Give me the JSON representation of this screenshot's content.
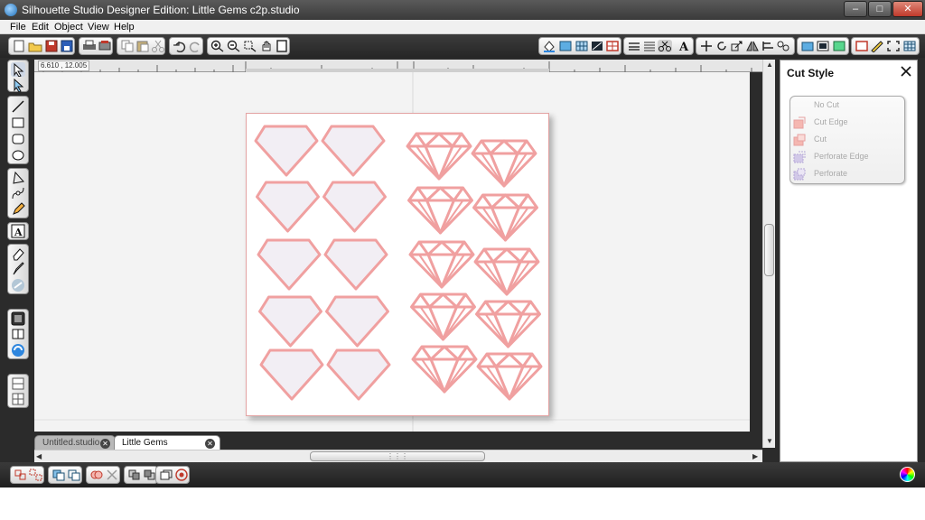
{
  "window": {
    "title": "Silhouette Studio Designer Edition: Little Gems c2p.studio",
    "controls": {
      "minimize": "–",
      "maximize": "□",
      "close": "✕"
    }
  },
  "menu": {
    "items": [
      "File",
      "Edit",
      "Object",
      "View",
      "Help"
    ]
  },
  "ruler": {
    "readout": "6.610 , 12.005"
  },
  "tabs": [
    {
      "label": "Untitled.studio",
      "active": false
    },
    {
      "label": "Little Gems c2p.studio",
      "active": true
    }
  ],
  "panel": {
    "title": "Cut Style",
    "options": [
      {
        "label": "No Cut",
        "icon": "no-cut-icon"
      },
      {
        "label": "Cut Edge",
        "icon": "cut-edge-icon"
      },
      {
        "label": "Cut",
        "icon": "cut-icon"
      },
      {
        "label": "Perforate Edge",
        "icon": "perforate-edge-icon"
      },
      {
        "label": "Perforate",
        "icon": "perforate-icon"
      }
    ]
  },
  "design": {
    "shape_stroke": "#f0a0a0",
    "shape_fill": "#f2eef4",
    "left_column": "outlined-gem shapes",
    "right_column": "faceted diamond shapes"
  },
  "colors": {
    "chrome_dark": "#2b2b2b",
    "menu_bg": "#f0f0f0",
    "workspace_bg": "#f3f3f3",
    "shape_stroke": "#f0a0a0"
  }
}
